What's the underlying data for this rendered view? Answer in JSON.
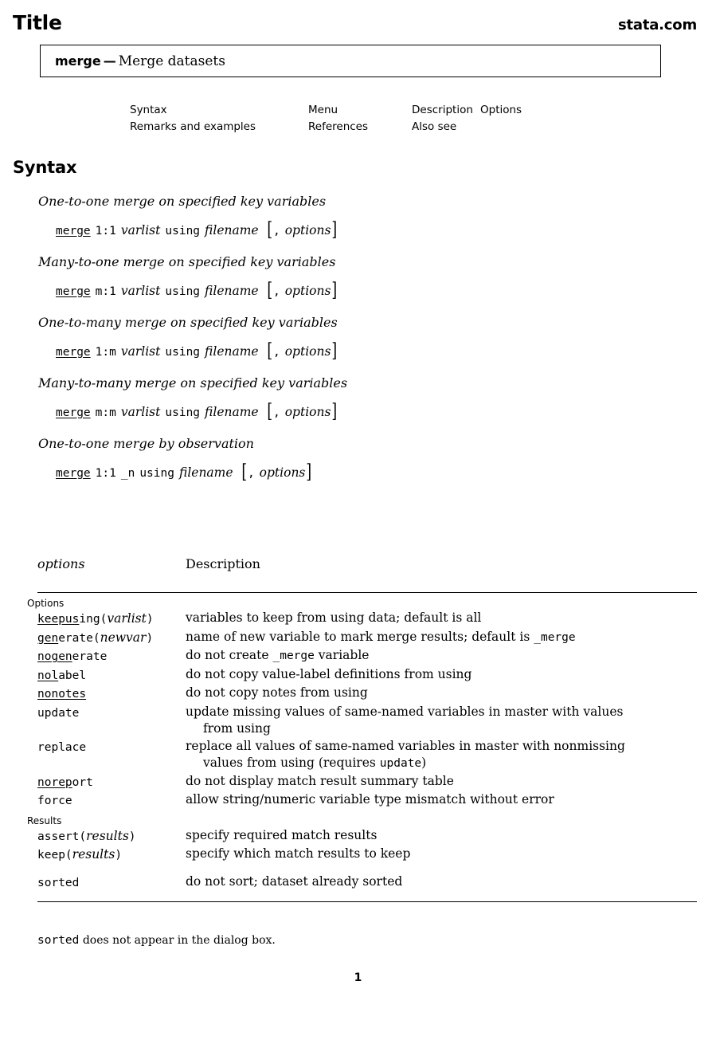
{
  "header": {
    "title": "Title",
    "site": "stata.com"
  },
  "title_box": {
    "command": "merge",
    "dash": "—",
    "description": "Merge datasets"
  },
  "nav_links": [
    [
      "Syntax",
      "Menu",
      "Description",
      "Options"
    ],
    [
      "Remarks and examples",
      "References",
      "Also see",
      ""
    ]
  ],
  "sections": {
    "syntax_heading": "Syntax"
  },
  "syntax_blocks": [
    {
      "label": "One-to-one merge on specified key variables",
      "cmd_underlined": "merge",
      "spec": "1:1",
      "arg": "varlist",
      "arg_style": "italic",
      "using": "using",
      "filename": "filename",
      "bracket_open": "[",
      "comma": ",",
      "options": "options",
      "bracket_close": "]"
    },
    {
      "label": "Many-to-one merge on specified key variables",
      "cmd_underlined": "merge",
      "spec": "m:1",
      "arg": "varlist",
      "arg_style": "italic",
      "using": "using",
      "filename": "filename",
      "bracket_open": "[",
      "comma": ",",
      "options": "options",
      "bracket_close": "]"
    },
    {
      "label": "One-to-many merge on specified key variables",
      "cmd_underlined": "merge",
      "spec": "1:m",
      "arg": "varlist",
      "arg_style": "italic",
      "using": "using",
      "filename": "filename",
      "bracket_open": "[",
      "comma": ",",
      "options": "options",
      "bracket_close": "]"
    },
    {
      "label": "Many-to-many merge on specified key variables",
      "cmd_underlined": "merge",
      "spec": "m:m",
      "arg": "varlist",
      "arg_style": "italic",
      "using": "using",
      "filename": "filename",
      "bracket_open": "[",
      "comma": ",",
      "options": "options",
      "bracket_close": "]"
    },
    {
      "label": "One-to-one merge by observation",
      "cmd_underlined": "merge",
      "spec": "1:1",
      "arg": "_n",
      "arg_style": "mono",
      "using": "using",
      "filename": "filename",
      "bracket_open": "[",
      "comma": ",",
      "options": "options",
      "bracket_close": "]"
    }
  ],
  "options_table": {
    "col_options": "options",
    "col_description": "Description",
    "groups": [
      {
        "label": "Options",
        "rows": [
          {
            "name_underlined": "keepus",
            "name_rest": "ing",
            "arg": "varlist",
            "desc": "variables to keep from using data; default is all",
            "desc_cont": "",
            "desc_mono_tail": ""
          },
          {
            "name_underlined": "gen",
            "name_rest": "erate",
            "arg": "newvar",
            "desc": "name of new variable to mark merge results; default is ",
            "desc_mono_tail": "_merge",
            "desc_cont": ""
          },
          {
            "name_underlined": "nogen",
            "name_rest": "erate",
            "arg": "",
            "desc": "do not create ",
            "desc_mono_mid": "_merge",
            "desc_after": " variable",
            "desc_cont": ""
          },
          {
            "name_underlined": "nol",
            "name_rest": "abel",
            "arg": "",
            "desc": "do not copy value-label definitions from using",
            "desc_cont": ""
          },
          {
            "name_underlined": "nonotes",
            "name_rest": "",
            "arg": "",
            "desc": "do not copy notes from using",
            "desc_cont": ""
          },
          {
            "name_underlined": "",
            "name_rest": "update",
            "arg": "",
            "desc": "update missing values of same-named variables in master with values",
            "desc_cont": "from using"
          },
          {
            "name_underlined": "",
            "name_rest": "replace",
            "arg": "",
            "desc": "replace all values of same-named variables in master with nonmissing",
            "desc_cont": "values from using (requires ",
            "cont_mono": "update",
            "cont_after": ")"
          },
          {
            "name_underlined": "norep",
            "name_rest": "ort",
            "arg": "",
            "desc": "do not display match result summary table",
            "desc_cont": ""
          },
          {
            "name_underlined": "",
            "name_rest": "force",
            "arg": "",
            "desc": "allow string/numeric variable type mismatch without error",
            "desc_cont": ""
          }
        ]
      },
      {
        "label": "Results",
        "rows": [
          {
            "name_underlined": "",
            "name_rest": "assert",
            "arg": "results",
            "desc": "specify required match results",
            "desc_cont": ""
          },
          {
            "name_underlined": "",
            "name_rest": "keep",
            "arg": "results",
            "desc": "specify which match results to keep",
            "desc_cont": ""
          },
          {
            "name_underlined": "",
            "name_rest": "sorted",
            "arg": "",
            "desc": "do not sort; dataset already sorted",
            "desc_cont": "",
            "spaced": true
          }
        ]
      }
    ]
  },
  "footnote": {
    "mono": "sorted",
    "text": " does not appear in the dialog box."
  },
  "page_number": "1"
}
